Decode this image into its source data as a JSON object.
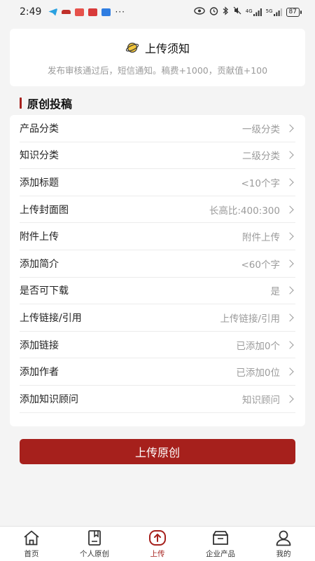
{
  "status_bar": {
    "time": "2:49",
    "dots": "···",
    "network_4g": "4G",
    "network_5g": "5G",
    "battery": "87"
  },
  "notice": {
    "title": "上传须知",
    "text": "发布审核通过后，短信通知。稿费+1000，贡献值+100",
    "icon": "planet-icon"
  },
  "section": {
    "title": "原创投稿"
  },
  "form_rows": [
    {
      "label": "产品分类",
      "value": "一级分类"
    },
    {
      "label": "知识分类",
      "value": "二级分类"
    },
    {
      "label": "添加标题",
      "value": "<10个字"
    },
    {
      "label": "上传封面图",
      "value": "长高比:400:300"
    },
    {
      "label": "附件上传",
      "value": "附件上传"
    },
    {
      "label": "添加简介",
      "value": "<60个字"
    },
    {
      "label": "是否可下载",
      "value": "是"
    },
    {
      "label": "上传链接/引用",
      "value": "上传链接/引用"
    },
    {
      "label": "添加链接",
      "value": "已添加0个"
    },
    {
      "label": "添加作者",
      "value": "已添加0位"
    },
    {
      "label": "添加知识顾问",
      "value": "知识顾问"
    }
  ],
  "submit": {
    "label": "上传原创"
  },
  "tabs": [
    {
      "label": "首页",
      "icon": "home-icon"
    },
    {
      "label": "个人原创",
      "icon": "document-icon"
    },
    {
      "label": "上传",
      "icon": "upload-icon",
      "active": true
    },
    {
      "label": "企业产品",
      "icon": "box-icon"
    },
    {
      "label": "我的",
      "icon": "user-icon"
    }
  ],
  "colors": {
    "accent": "#a6201c",
    "background": "#f4f4f4",
    "muted_text": "#9b9b9b"
  }
}
